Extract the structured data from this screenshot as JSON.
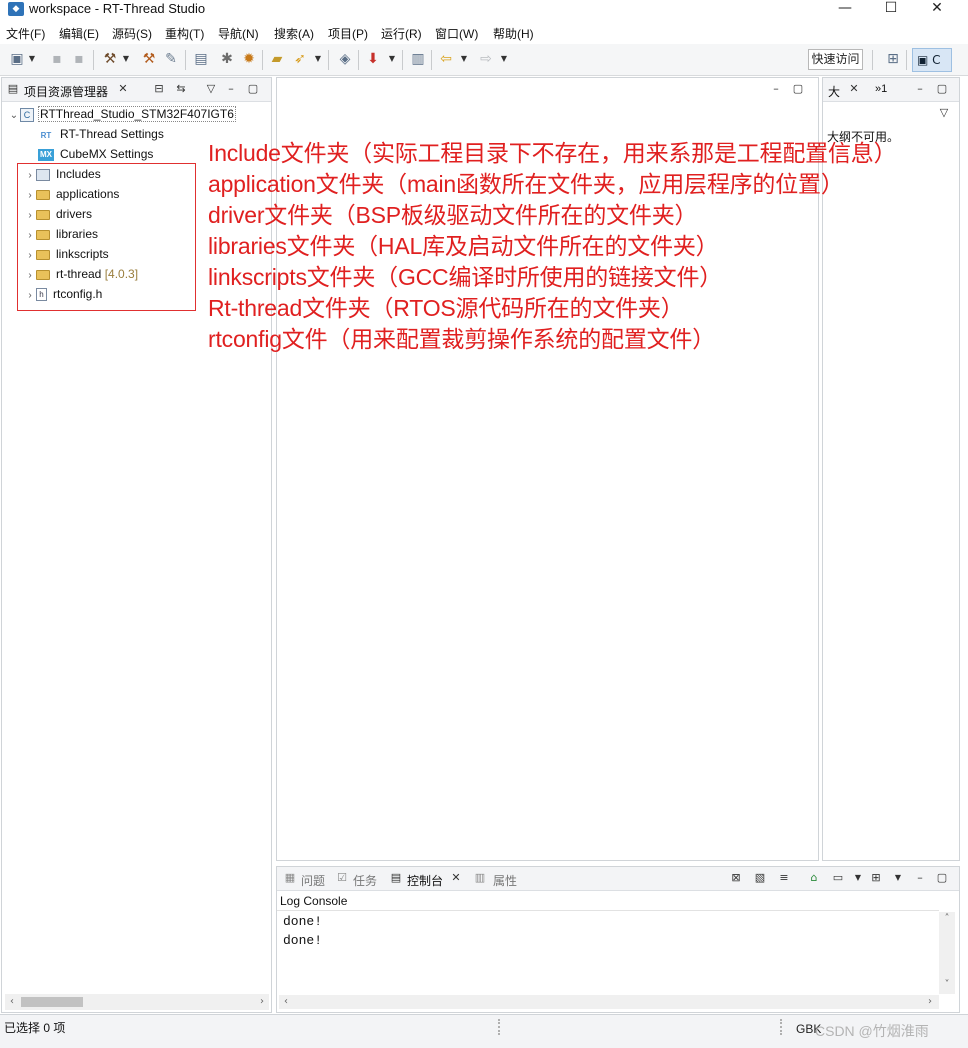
{
  "window": {
    "title": "workspace - RT-Thread Studio",
    "app_icon": "rt-thread-studio-icon"
  },
  "menu": [
    "文件(F)",
    "编辑(E)",
    "源码(S)",
    "重构(T)",
    "导航(N)",
    "搜索(A)",
    "项目(P)",
    "运行(R)",
    "窗口(W)",
    "帮助(H)"
  ],
  "toolbar": {
    "quick_access": "快速访问",
    "perspective_label": "C"
  },
  "explorer": {
    "title": "项目资源管理器",
    "project": "RTThread_Studio_STM32F407IGT6",
    "settings": [
      {
        "label": "RT-Thread Settings",
        "icon": "RT"
      },
      {
        "label": "CubeMX Settings",
        "icon": "MX"
      }
    ],
    "items": [
      {
        "label": "Includes",
        "type": "includes"
      },
      {
        "label": "applications",
        "type": "folder"
      },
      {
        "label": "drivers",
        "type": "folder"
      },
      {
        "label": "libraries",
        "type": "folder"
      },
      {
        "label": "linkscripts",
        "type": "folder"
      },
      {
        "label": "rt-thread",
        "type": "folder",
        "version": "[4.0.3]"
      },
      {
        "label": "rtconfig.h",
        "type": "file"
      }
    ]
  },
  "outline": {
    "tab_label": "大",
    "overflow_count": "»1",
    "message": "大纲不可用。"
  },
  "annotations": [
    "Include文件夹（实际工程目录下不存在，用来系那是工程配置信息）",
    "application文件夹（main函数所在文件夹，应用层程序的位置）",
    "driver文件夹（BSP板级驱动文件所在的文件夹）",
    "libraries文件夹（HAL库及启动文件所在的文件夹）",
    "linkscripts文件夹（GCC编译时所使用的链接文件）",
    "Rt-thread文件夹（RTOS源代码所在的文件夹）",
    "rtconfig文件（用来配置裁剪操作系统的配置文件）"
  ],
  "console": {
    "tabs": [
      "问题",
      "任务",
      "控制台",
      "属性"
    ],
    "active_tab": "控制台",
    "title": "Log Console",
    "lines": [
      "done!",
      "done!"
    ]
  },
  "status": {
    "selection": "已选择 0 项",
    "encoding": "GBK",
    "watermark": "CSDN @竹烟淮雨"
  },
  "colors": {
    "annotation_red": "#e02020",
    "highlight_box": "#e03030"
  }
}
